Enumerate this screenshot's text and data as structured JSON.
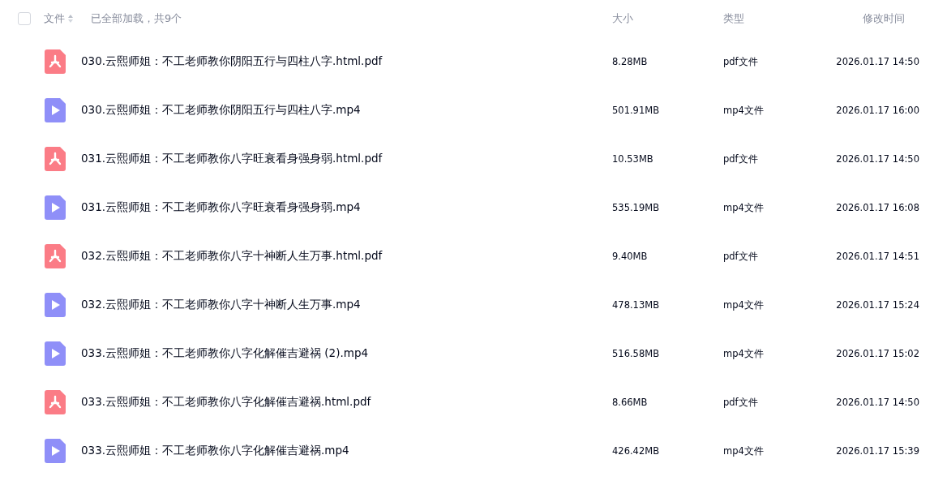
{
  "header": {
    "select_all": {
      "checked": false
    },
    "name_column": "文件",
    "load_status": "已全部加载，共9个",
    "size_column": "大小",
    "type_column": "类型",
    "time_column": "修改时间"
  },
  "files": [
    {
      "kind": "pdf",
      "name": "030.云熙师姐：不工老师教你阴阳五行与四柱八字.html.pdf",
      "size": "8.28MB",
      "type": "pdf文件",
      "modified": "2026.01.17 14:50"
    },
    {
      "kind": "video",
      "name": "030.云熙师姐：不工老师教你阴阳五行与四柱八字.mp4",
      "size": "501.91MB",
      "type": "mp4文件",
      "modified": "2026.01.17 16:00"
    },
    {
      "kind": "pdf",
      "name": "031.云熙师姐：不工老师教你八字旺衰看身强身弱.html.pdf",
      "size": "10.53MB",
      "type": "pdf文件",
      "modified": "2026.01.17 14:50"
    },
    {
      "kind": "video",
      "name": "031.云熙师姐：不工老师教你八字旺衰看身强身弱.mp4",
      "size": "535.19MB",
      "type": "mp4文件",
      "modified": "2026.01.17 16:08"
    },
    {
      "kind": "pdf",
      "name": "032.云熙师姐：不工老师教你八字十神断人生万事.html.pdf",
      "size": "9.40MB",
      "type": "pdf文件",
      "modified": "2026.01.17 14:51"
    },
    {
      "kind": "video",
      "name": "032.云熙师姐：不工老师教你八字十神断人生万事.mp4",
      "size": "478.13MB",
      "type": "mp4文件",
      "modified": "2026.01.17 15:24"
    },
    {
      "kind": "video",
      "name": "033.云熙师姐：不工老师教你八字化解催吉避祸 (2).mp4",
      "size": "516.58MB",
      "type": "mp4文件",
      "modified": "2026.01.17 15:02"
    },
    {
      "kind": "pdf",
      "name": "033.云熙师姐：不工老师教你八字化解催吉避祸.html.pdf",
      "size": "8.66MB",
      "type": "pdf文件",
      "modified": "2026.01.17 14:50"
    },
    {
      "kind": "video",
      "name": "033.云熙师姐：不工老师教你八字化解催吉避祸.mp4",
      "size": "426.42MB",
      "type": "mp4文件",
      "modified": "2026.01.17 15:39"
    }
  ]
}
